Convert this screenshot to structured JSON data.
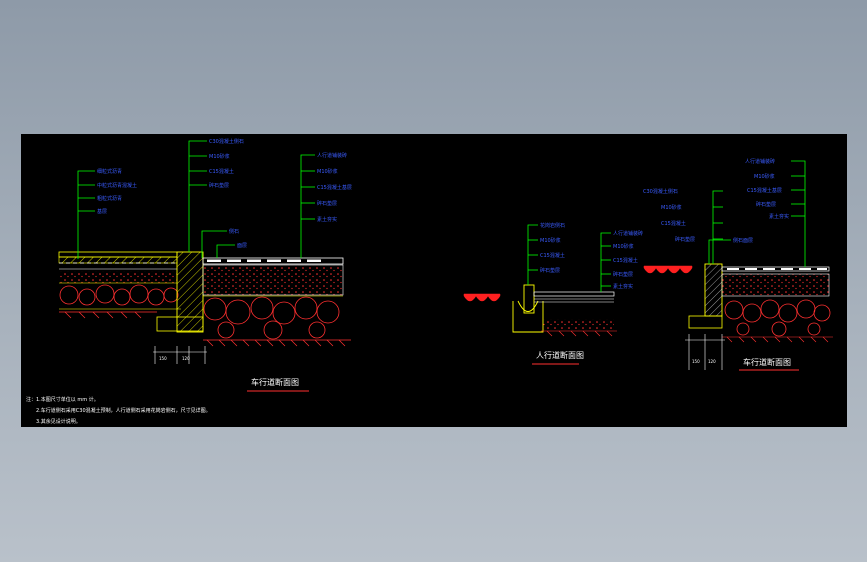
{
  "titles": {
    "left": "车行道断面图",
    "middle": "人行道断面图",
    "right": "车行道断面图"
  },
  "notes": {
    "line1": "注：1.本图尺寸单位以 mm 计。",
    "line2": "2.车行道侧石采用C30混凝土预制，人行道侧石采用花岗岩侧石，尺寸见详图。",
    "line3": "3.其余见设计说明。"
  },
  "colors": {
    "background": "#000000",
    "leader": "#00ff00",
    "label": "#3a5cff",
    "hatch": "#ff2020",
    "kerb": "#ffff00",
    "surface": "#ffffff"
  }
}
